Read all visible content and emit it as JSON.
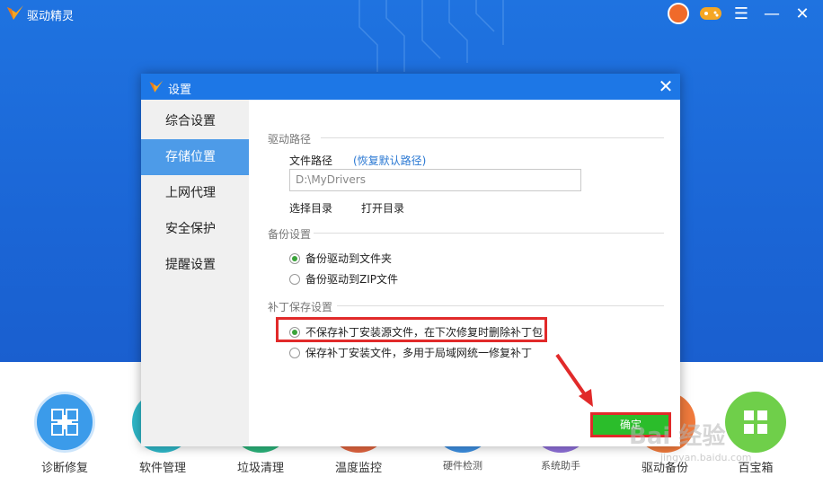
{
  "app": {
    "title": "驱动精灵"
  },
  "dialog": {
    "title": "设置",
    "close": "✕",
    "sidebar": [
      {
        "label": "综合设置"
      },
      {
        "label": "存储位置"
      },
      {
        "label": "上网代理"
      },
      {
        "label": "安全保护"
      },
      {
        "label": "提醒设置"
      }
    ],
    "driver_path": {
      "section": "驱动路径",
      "label": "文件路径",
      "restore_link": "(恢复默认路径)",
      "value": "D:\\MyDrivers",
      "select_dir": "选择目录",
      "open_dir": "打开目录"
    },
    "backup": {
      "section": "备份设置",
      "options": [
        {
          "label": "备份驱动到文件夹",
          "checked": true
        },
        {
          "label": "备份驱动到ZIP文件",
          "checked": false
        }
      ]
    },
    "patch": {
      "section": "补丁保存设置",
      "options": [
        {
          "label": "不保存补丁安装源文件，在下次修复时删除补丁包",
          "checked": true
        },
        {
          "label": "保存补丁安装文件，多用于局域网统一修复补丁",
          "checked": false
        }
      ]
    },
    "ok": "确定"
  },
  "tools": [
    {
      "label": "诊断修复",
      "color": "#3b9bea"
    },
    {
      "label": "软件管理",
      "color": "#2fb8c9"
    },
    {
      "label": "垃圾清理",
      "color": "#2bb37a"
    },
    {
      "label": "温度监控",
      "color": "#e0643f"
    },
    {
      "label": "硬件检测",
      "color": "#3d8fe0"
    },
    {
      "label": "系统助手",
      "color": "#8e6fd8"
    },
    {
      "label": "驱动备份",
      "color": "#f07a3c"
    },
    {
      "label": "百宝箱",
      "color": "#6fcf4a"
    }
  ],
  "watermark": {
    "text": "Bai 经验",
    "sub": "jingyan.baidu.com"
  },
  "colors": {
    "brand_blue": "#1d77e6",
    "accent_green": "#2bbd2b",
    "highlight_red": "#e12a2a"
  }
}
